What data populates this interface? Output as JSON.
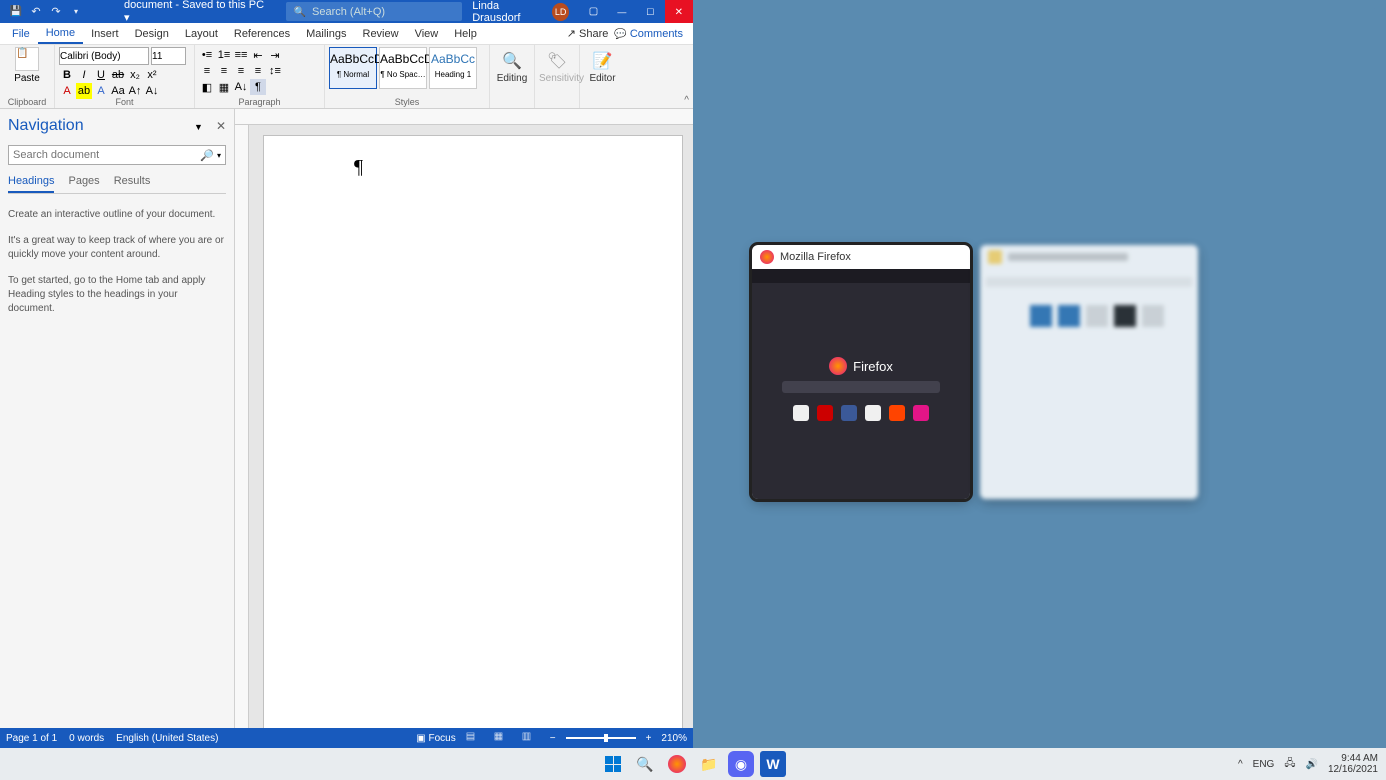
{
  "titlebar": {
    "doc_title": "document - Saved to this PC ▾",
    "search_placeholder": "Search (Alt+Q)",
    "user_name": "Linda Drausdorf",
    "user_initials": "LD"
  },
  "menubar": {
    "file": "File",
    "home": "Home",
    "insert": "Insert",
    "design": "Design",
    "layout": "Layout",
    "references": "References",
    "mailings": "Mailings",
    "review": "Review",
    "view": "View",
    "help": "Help",
    "share": "Share",
    "comments": "Comments"
  },
  "ribbon": {
    "paste": "Paste",
    "clipboard": "Clipboard",
    "font_name": "Calibri (Body)",
    "font_size": "11",
    "font": "Font",
    "paragraph": "Paragraph",
    "styles": "Styles",
    "style_normal_sample": "AaBbCcDd",
    "style_normal": "¶ Normal",
    "style_nospace_sample": "AaBbCcDd",
    "style_nospace": "¶ No Spac…",
    "style_h1_sample": "AaBbCc",
    "style_h1": "Heading 1",
    "editing": "Editing",
    "sensitivity": "Sensitivity",
    "editor": "Editor"
  },
  "navpane": {
    "title": "Navigation",
    "search_placeholder": "Search document",
    "tab_headings": "Headings",
    "tab_pages": "Pages",
    "tab_results": "Results",
    "p1": "Create an interactive outline of your document.",
    "p2": "It's a great way to keep track of where you are or quickly move your content around.",
    "p3": "To get started, go to the Home tab and apply Heading styles to the headings in your document."
  },
  "doc": {
    "pilcrow": "¶"
  },
  "statusbar": {
    "page": "Page 1 of 1",
    "words": "0 words",
    "lang": "English (United States)",
    "focus": "Focus",
    "zoom": "210%"
  },
  "snap": {
    "firefox_title": "Mozilla Firefox",
    "firefox_brand": "Firefox"
  },
  "systray": {
    "lang": "ENG",
    "time": "9:44 AM",
    "date": "12/16/2021"
  }
}
